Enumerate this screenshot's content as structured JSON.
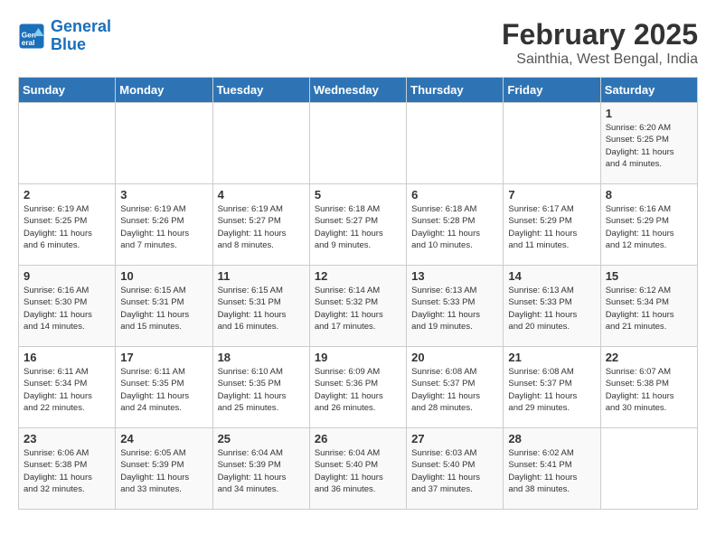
{
  "logo": {
    "line1": "General",
    "line2": "Blue"
  },
  "title": "February 2025",
  "subtitle": "Sainthia, West Bengal, India",
  "days_of_week": [
    "Sunday",
    "Monday",
    "Tuesday",
    "Wednesday",
    "Thursday",
    "Friday",
    "Saturday"
  ],
  "weeks": [
    [
      {
        "day": "",
        "info": ""
      },
      {
        "day": "",
        "info": ""
      },
      {
        "day": "",
        "info": ""
      },
      {
        "day": "",
        "info": ""
      },
      {
        "day": "",
        "info": ""
      },
      {
        "day": "",
        "info": ""
      },
      {
        "day": "1",
        "info": "Sunrise: 6:20 AM\nSunset: 5:25 PM\nDaylight: 11 hours\nand 4 minutes."
      }
    ],
    [
      {
        "day": "2",
        "info": "Sunrise: 6:19 AM\nSunset: 5:25 PM\nDaylight: 11 hours\nand 6 minutes."
      },
      {
        "day": "3",
        "info": "Sunrise: 6:19 AM\nSunset: 5:26 PM\nDaylight: 11 hours\nand 7 minutes."
      },
      {
        "day": "4",
        "info": "Sunrise: 6:19 AM\nSunset: 5:27 PM\nDaylight: 11 hours\nand 8 minutes."
      },
      {
        "day": "5",
        "info": "Sunrise: 6:18 AM\nSunset: 5:27 PM\nDaylight: 11 hours\nand 9 minutes."
      },
      {
        "day": "6",
        "info": "Sunrise: 6:18 AM\nSunset: 5:28 PM\nDaylight: 11 hours\nand 10 minutes."
      },
      {
        "day": "7",
        "info": "Sunrise: 6:17 AM\nSunset: 5:29 PM\nDaylight: 11 hours\nand 11 minutes."
      },
      {
        "day": "8",
        "info": "Sunrise: 6:16 AM\nSunset: 5:29 PM\nDaylight: 11 hours\nand 12 minutes."
      }
    ],
    [
      {
        "day": "9",
        "info": "Sunrise: 6:16 AM\nSunset: 5:30 PM\nDaylight: 11 hours\nand 14 minutes."
      },
      {
        "day": "10",
        "info": "Sunrise: 6:15 AM\nSunset: 5:31 PM\nDaylight: 11 hours\nand 15 minutes."
      },
      {
        "day": "11",
        "info": "Sunrise: 6:15 AM\nSunset: 5:31 PM\nDaylight: 11 hours\nand 16 minutes."
      },
      {
        "day": "12",
        "info": "Sunrise: 6:14 AM\nSunset: 5:32 PM\nDaylight: 11 hours\nand 17 minutes."
      },
      {
        "day": "13",
        "info": "Sunrise: 6:13 AM\nSunset: 5:33 PM\nDaylight: 11 hours\nand 19 minutes."
      },
      {
        "day": "14",
        "info": "Sunrise: 6:13 AM\nSunset: 5:33 PM\nDaylight: 11 hours\nand 20 minutes."
      },
      {
        "day": "15",
        "info": "Sunrise: 6:12 AM\nSunset: 5:34 PM\nDaylight: 11 hours\nand 21 minutes."
      }
    ],
    [
      {
        "day": "16",
        "info": "Sunrise: 6:11 AM\nSunset: 5:34 PM\nDaylight: 11 hours\nand 22 minutes."
      },
      {
        "day": "17",
        "info": "Sunrise: 6:11 AM\nSunset: 5:35 PM\nDaylight: 11 hours\nand 24 minutes."
      },
      {
        "day": "18",
        "info": "Sunrise: 6:10 AM\nSunset: 5:35 PM\nDaylight: 11 hours\nand 25 minutes."
      },
      {
        "day": "19",
        "info": "Sunrise: 6:09 AM\nSunset: 5:36 PM\nDaylight: 11 hours\nand 26 minutes."
      },
      {
        "day": "20",
        "info": "Sunrise: 6:08 AM\nSunset: 5:37 PM\nDaylight: 11 hours\nand 28 minutes."
      },
      {
        "day": "21",
        "info": "Sunrise: 6:08 AM\nSunset: 5:37 PM\nDaylight: 11 hours\nand 29 minutes."
      },
      {
        "day": "22",
        "info": "Sunrise: 6:07 AM\nSunset: 5:38 PM\nDaylight: 11 hours\nand 30 minutes."
      }
    ],
    [
      {
        "day": "23",
        "info": "Sunrise: 6:06 AM\nSunset: 5:38 PM\nDaylight: 11 hours\nand 32 minutes."
      },
      {
        "day": "24",
        "info": "Sunrise: 6:05 AM\nSunset: 5:39 PM\nDaylight: 11 hours\nand 33 minutes."
      },
      {
        "day": "25",
        "info": "Sunrise: 6:04 AM\nSunset: 5:39 PM\nDaylight: 11 hours\nand 34 minutes."
      },
      {
        "day": "26",
        "info": "Sunrise: 6:04 AM\nSunset: 5:40 PM\nDaylight: 11 hours\nand 36 minutes."
      },
      {
        "day": "27",
        "info": "Sunrise: 6:03 AM\nSunset: 5:40 PM\nDaylight: 11 hours\nand 37 minutes."
      },
      {
        "day": "28",
        "info": "Sunrise: 6:02 AM\nSunset: 5:41 PM\nDaylight: 11 hours\nand 38 minutes."
      },
      {
        "day": "",
        "info": ""
      }
    ]
  ]
}
